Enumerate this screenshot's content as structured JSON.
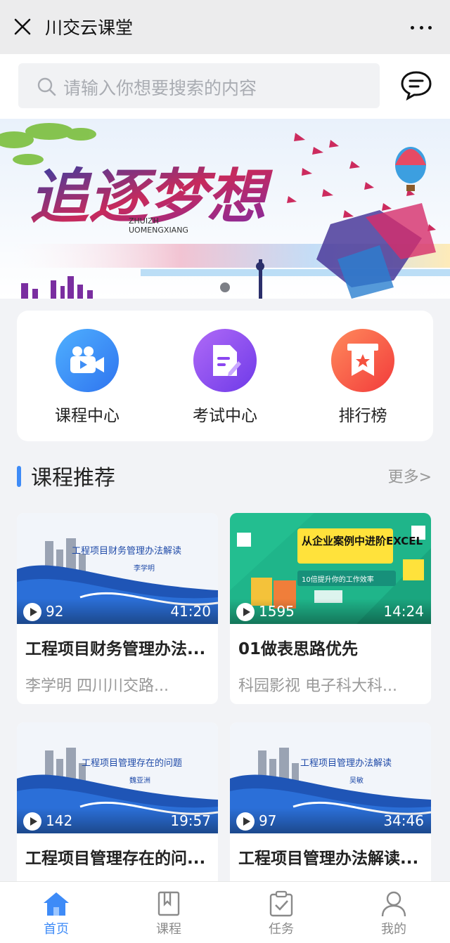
{
  "header": {
    "title": "川交云课堂"
  },
  "search": {
    "placeholder": "请输入你想要搜索的内容"
  },
  "banner": {
    "title": "追逐梦想",
    "pinyin_line1": "ZHUIZH",
    "pinyin_line2": "UOMENGXIANG"
  },
  "quick": [
    {
      "label": "课程中心",
      "icon": "video-camera-icon",
      "color": "#3f8ef5"
    },
    {
      "label": "考试中心",
      "icon": "exam-paper-icon",
      "color": "#8a45f0"
    },
    {
      "label": "排行榜",
      "icon": "ranking-award-icon",
      "color": "#f5523f"
    }
  ],
  "section": {
    "title": "课程推荐",
    "more": "更多>"
  },
  "courses": [
    {
      "thumb_title": "工程项目财务管理办法解读",
      "thumb_author": "李学明",
      "views": "92",
      "duration": "41:20",
      "title": "工程项目财务管理办法...",
      "meta": "李学明 四川川交路..."
    },
    {
      "thumb_title": "从企业案例中进阶EXCEL",
      "thumb_sub": "10倍提升你的工作效率",
      "views": "1595",
      "duration": "14:24",
      "title": "01做表思路优先",
      "meta": "科园影视 电子科大科..."
    },
    {
      "thumb_title": "工程项目管理存在的问题",
      "thumb_author": "魏亚洲",
      "views": "142",
      "duration": "19:57",
      "title": "工程项目管理存在的问...",
      "meta": ""
    },
    {
      "thumb_title": "工程项目管理办法解读",
      "thumb_author": "吴敏",
      "views": "97",
      "duration": "34:46",
      "title": "工程项目管理办法解读...",
      "meta": ""
    }
  ],
  "tabs": [
    {
      "label": "首页",
      "icon": "home-icon",
      "active": true
    },
    {
      "label": "课程",
      "icon": "course-icon",
      "active": false
    },
    {
      "label": "任务",
      "icon": "task-icon",
      "active": false
    },
    {
      "label": "我的",
      "icon": "profile-icon",
      "active": false
    }
  ],
  "colors": {
    "accent": "#3e8bf7"
  }
}
